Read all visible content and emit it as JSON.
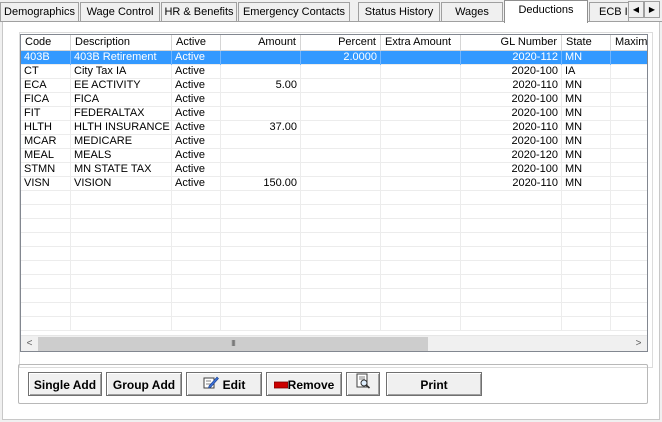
{
  "tabs": [
    {
      "label": "Demographics"
    },
    {
      "label": "Wage Control"
    },
    {
      "label": "HR & Benefits"
    },
    {
      "label": "Emergency Contacts"
    },
    {
      "label": "Status History"
    },
    {
      "label": "Wages"
    },
    {
      "label": "Deductions",
      "active": true
    },
    {
      "label": "ECB I"
    }
  ],
  "tab_scroll": {
    "left_glyph": "◀",
    "right_glyph": "▶"
  },
  "grid": {
    "columns": [
      "Code",
      "Description",
      "Active",
      "Amount",
      "Percent",
      "Extra Amount",
      "GL Number",
      "State",
      "Maxim"
    ],
    "rows": [
      {
        "code": "403B",
        "description": "403B Retirement",
        "active": "Active",
        "amount": "",
        "percent": "2.0000",
        "extra": "",
        "gl": "2020-112",
        "state": "MN",
        "max": "",
        "selected": true
      },
      {
        "code": "CT",
        "description": "City Tax IA",
        "active": "Active",
        "amount": "",
        "percent": "",
        "extra": "",
        "gl": "2020-100",
        "state": "IA",
        "max": ""
      },
      {
        "code": "ECA",
        "description": "EE ACTIVITY",
        "active": "Active",
        "amount": "5.00",
        "percent": "",
        "extra": "",
        "gl": "2020-110",
        "state": "MN",
        "max": ""
      },
      {
        "code": "FICA",
        "description": "FICA",
        "active": "Active",
        "amount": "",
        "percent": "",
        "extra": "",
        "gl": "2020-100",
        "state": "MN",
        "max": ""
      },
      {
        "code": "FIT",
        "description": "FEDERALTAX",
        "active": "Active",
        "amount": "",
        "percent": "",
        "extra": "",
        "gl": "2020-100",
        "state": "MN",
        "max": ""
      },
      {
        "code": "HLTH",
        "description": "HLTH INSURANCE",
        "active": "Active",
        "amount": "37.00",
        "percent": "",
        "extra": "",
        "gl": "2020-110",
        "state": "MN",
        "max": ""
      },
      {
        "code": "MCAR",
        "description": "MEDICARE",
        "active": "Active",
        "amount": "",
        "percent": "",
        "extra": "",
        "gl": "2020-100",
        "state": "MN",
        "max": ""
      },
      {
        "code": "MEAL",
        "description": "MEALS",
        "active": "Active",
        "amount": "",
        "percent": "",
        "extra": "",
        "gl": "2020-120",
        "state": "MN",
        "max": ""
      },
      {
        "code": "STMN",
        "description": "MN STATE TAX",
        "active": "Active",
        "amount": "",
        "percent": "",
        "extra": "",
        "gl": "2020-100",
        "state": "MN",
        "max": ""
      },
      {
        "code": "VISN",
        "description": "VISION",
        "active": "Active",
        "amount": "150.00",
        "percent": "",
        "extra": "",
        "gl": "2020-110",
        "state": "MN",
        "max": ""
      }
    ],
    "empty_rows": 10
  },
  "scrollbar": {
    "left_glyph": "<",
    "right_glyph": ">",
    "thumb_glyph": "III"
  },
  "buttons": {
    "single_add": "Single Add",
    "group_add": "Group Add",
    "edit": "Edit",
    "remove": "Remove",
    "print": "Print"
  },
  "colors": {
    "selection": "#3399ff",
    "remove_icon": "#cc0000"
  }
}
